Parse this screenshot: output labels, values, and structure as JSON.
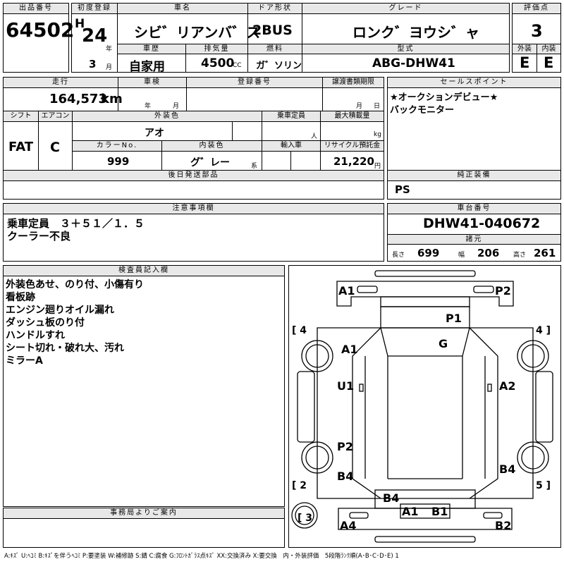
{
  "header": {
    "lot_no_label": "出品番号",
    "lot_no": "64502",
    "first_reg_label": "初度登録",
    "era": "H",
    "reg_year": "24",
    "year_unit": "年",
    "reg_month": "3",
    "month_unit": "月",
    "car_name_label": "車名",
    "car_name": "シビ゛リアンバ゛ス",
    "door_label": "ドア形状",
    "door": "2BUS",
    "grade_label": "グレード",
    "grade": "ロンク゛ヨウシ゛ャ",
    "score_label": "評価点",
    "score": "3",
    "history_label": "車歴",
    "history": "自家用",
    "displacement_label": "排気量",
    "displacement": "4500",
    "displacement_unit": "CC",
    "fuel_label": "燃料",
    "fuel": "ガ゛ソリン",
    "model_label": "型式",
    "model": "ABG-DHW41",
    "ext_label": "外装",
    "ext_grade": "E",
    "int_label": "内装",
    "int_grade": "E"
  },
  "row2": {
    "mileage_label": "走行",
    "mileage": "164,573",
    "mileage_unit": "km",
    "inspection_label": "車検",
    "insp_year_unit": "年",
    "insp_month_unit": "月",
    "plate_label": "登録番号",
    "transfer_label": "譲渡書類期限",
    "transfer_month_unit": "月",
    "transfer_day_unit": "日",
    "sales_label": "セールスポイント",
    "sales_points": [
      "★オークションデビュー★",
      "バックモニター"
    ]
  },
  "row3": {
    "shift_label": "シフト",
    "shift": "FAT",
    "ac_label": "エアコン",
    "ac": "C",
    "color_label": "外装色",
    "color": "アオ",
    "capacity_label": "乗車定員",
    "capacity_unit": "人",
    "load_label": "最大積載量",
    "load_unit": "kg",
    "color_no_label": "カラーNo.",
    "color_no": "999",
    "int_color_label": "内装色",
    "int_color": "グ゛レー",
    "int_color_suffix": "系",
    "import_label": "輸入車",
    "recycle_label": "リサイクル預託金",
    "recycle": "21,220",
    "recycle_unit": "円"
  },
  "later_parts_label": "後日発送部品",
  "genuine_label": "純正装備",
  "genuine": "PS",
  "notes_label": "注意事項欄",
  "notes": [
    "乗車定員　３＋５１／１．５",
    "クーラー不良"
  ],
  "chassis_label": "車台番号",
  "chassis": "DHW41-040672",
  "specs_label": "諸元",
  "length_label": "長さ",
  "length": "699",
  "width_label": "幅",
  "width": "206",
  "height_label": "高さ",
  "height": "261",
  "inspector_label": "検査員記入欄",
  "inspector_notes": [
    "外装色あせ、のり付、小傷有り",
    "看板跡",
    "エンジン廻りオイル漏れ",
    "ダッシュ板のり付",
    "ハンドルすれ",
    "シート切れ・破れ大、汚れ",
    "ミラーA"
  ],
  "office_label": "事務局よりご案内",
  "legend": "A:ｷｽﾞ U:ﾍｺﾐ B:ｷｽﾞを伴うﾍｺﾐ P:要塗装 W:補修跡 S:錆 C:腐食 G:ﾌﾛﾝﾄｶﾞﾗｽ点ｷｽﾞ XX:交換済み X:要交換　内・外装評価　5段階ﾗﾝｸ順(A･B･C･D･E) 1",
  "diagram": {
    "marks": {
      "front_left": "A1",
      "front_right": "P2",
      "roof_front": "P1",
      "glass": "G",
      "left_front_wheel": "A1",
      "left_side": "U1",
      "right_side": "A2",
      "left_rear_wheel": "P2",
      "left_rear": "B4",
      "right_rear_wheel": "B4",
      "rear_top": "B4",
      "rear_a1": "A1",
      "rear_b1": "B1",
      "rear_left": "A4",
      "rear_right": "B2"
    },
    "corners": {
      "tl": "4",
      "tr": "4",
      "bl": "2",
      "br": "5",
      "bottom": "3"
    }
  }
}
